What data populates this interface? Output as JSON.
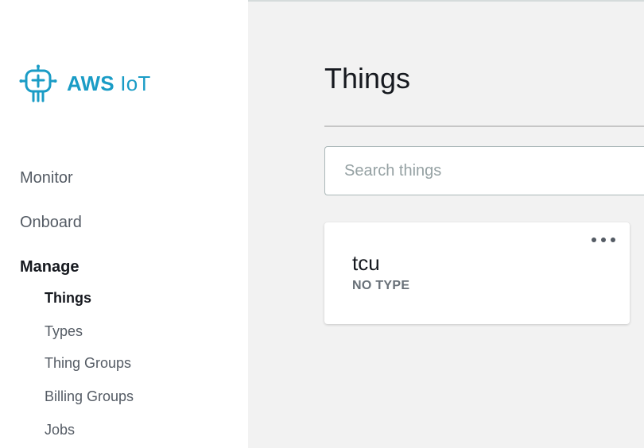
{
  "brand": {
    "name_bold": "AWS",
    "name_rest": "IoT",
    "color": "#1a9cc6",
    "icon": "aws-iot-chip-icon"
  },
  "sidebar": {
    "items": [
      {
        "label": "Monitor"
      },
      {
        "label": "Onboard"
      },
      {
        "label": "Manage",
        "active": true
      }
    ],
    "manage_subitems": [
      {
        "label": "Things",
        "active": true
      },
      {
        "label": "Types"
      },
      {
        "label": "Thing Groups"
      },
      {
        "label": "Billing Groups"
      },
      {
        "label": "Jobs"
      }
    ]
  },
  "main": {
    "title": "Things",
    "search": {
      "placeholder": "Search things",
      "value": ""
    },
    "things": [
      {
        "name": "tcu",
        "type": "NO TYPE",
        "menu_icon": "more-options-icon"
      }
    ]
  }
}
